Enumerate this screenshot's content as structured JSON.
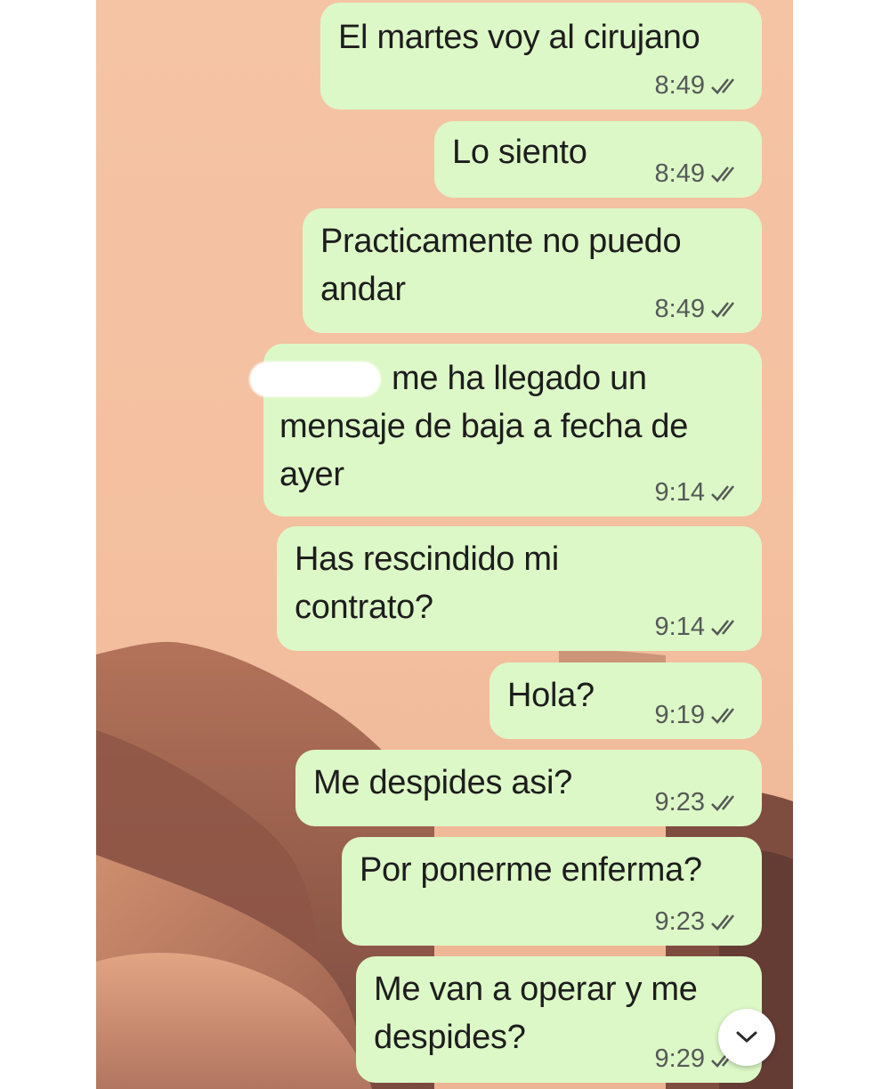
{
  "messages": [
    {
      "text": "El martes voy al cirujano",
      "time": "8:49"
    },
    {
      "text": "Lo siento",
      "time": "8:49"
    },
    {
      "text": "Practicamente no puedo\nandar",
      "time": "8:49"
    },
    {
      "text": "me ha llegado un\nmensaje de baja a fecha de\nayer",
      "time": "9:14"
    },
    {
      "text": "Has rescindido mi\ncontrato?",
      "time": "9:14"
    },
    {
      "text": "Hola?",
      "time": "9:19"
    },
    {
      "text": "Me despides asi?",
      "time": "9:23"
    },
    {
      "text": "Por ponerme enferma?",
      "time": "9:23"
    },
    {
      "text": "Me van a operar y me\ndespides?",
      "time": "9:29"
    }
  ],
  "icons": {
    "read_receipt": "double-check-icon",
    "scroll_down": "chevron-down-icon"
  },
  "colors": {
    "bubble": "#dcf8c6",
    "wallpaper": "#f4c1a2"
  }
}
